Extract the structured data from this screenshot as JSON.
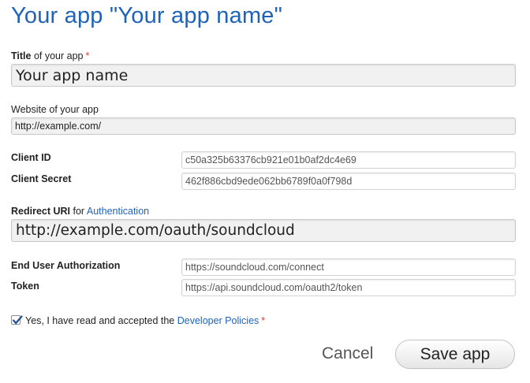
{
  "page": {
    "title": "Your app \"Your app name\""
  },
  "title_field": {
    "label_bold": "Title",
    "label_rest": " of your app",
    "required_mark": "*",
    "value": "Your app name"
  },
  "website_field": {
    "label": "Website of your app",
    "value": "http://example.com/"
  },
  "client_id": {
    "label": "Client ID",
    "value": "c50a325b63376cb921e01b0af2dc4e69"
  },
  "client_secret": {
    "label": "Client Secret",
    "value": "462f886cbd9ede062bb6789f0a0f798d"
  },
  "redirect_uri": {
    "label_bold": "Redirect URI",
    "label_rest": " for ",
    "label_link": "Authentication",
    "value": "http://example.com/oauth/soundcloud"
  },
  "end_user_auth": {
    "label": "End User Authorization",
    "value": "https://soundcloud.com/connect"
  },
  "token": {
    "label": "Token",
    "value": "https://api.soundcloud.com/oauth2/token"
  },
  "agreement": {
    "checked": true,
    "text": "Yes, I have read and accepted the ",
    "link": "Developer Policies",
    "required_mark": "*"
  },
  "actions": {
    "cancel_label": "Cancel",
    "save_label": "Save app"
  },
  "colors": {
    "title_blue": "#1f63b8",
    "required_red": "#e0343b",
    "field_bg": "#f1f1f1"
  }
}
